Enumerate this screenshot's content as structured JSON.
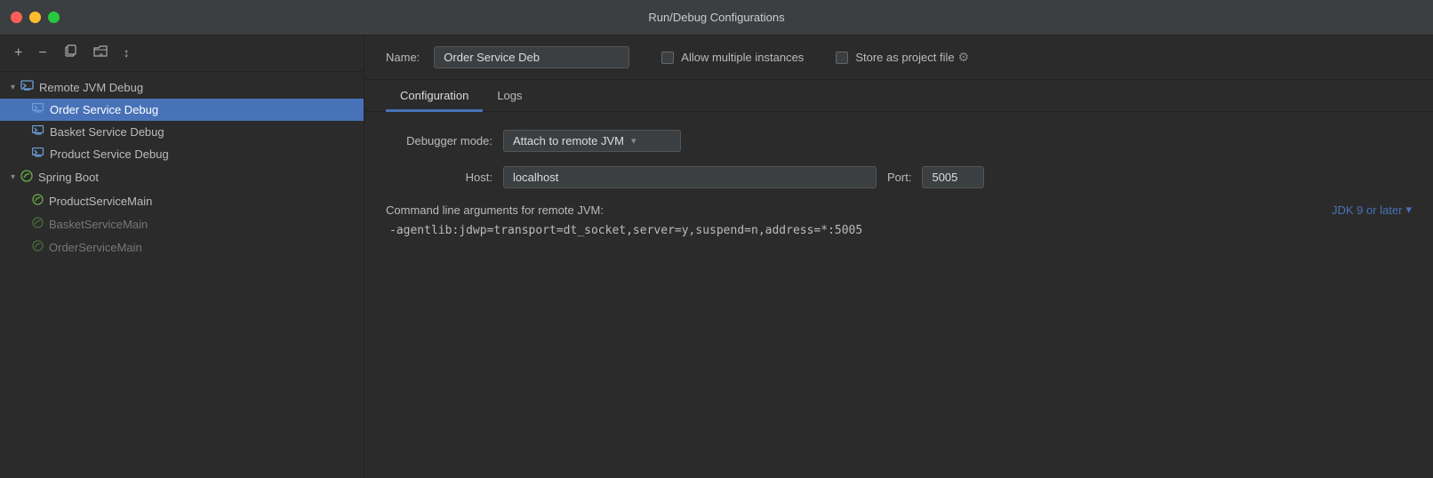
{
  "window": {
    "title": "Run/Debug Configurations"
  },
  "sidebar": {
    "toolbar": {
      "add_btn": "+",
      "remove_btn": "−",
      "copy_btn": "⧉",
      "folder_btn": "📁",
      "sort_btn": "↓₂"
    },
    "groups": [
      {
        "id": "remote-jvm",
        "label": "Remote JVM Debug",
        "icon": "🖥",
        "expanded": true,
        "items": [
          {
            "label": "Order Service Debug",
            "active": true,
            "dimmed": false
          },
          {
            "label": "Basket Service Debug",
            "active": false,
            "dimmed": false
          },
          {
            "label": "Product Service Debug",
            "active": false,
            "dimmed": false
          }
        ]
      },
      {
        "id": "spring-boot",
        "label": "Spring Boot",
        "icon": "🍃",
        "expanded": true,
        "items": [
          {
            "label": "ProductServiceMain",
            "active": false,
            "dimmed": false
          },
          {
            "label": "BasketServiceMain",
            "active": false,
            "dimmed": true
          },
          {
            "label": "OrderServiceMain",
            "active": false,
            "dimmed": true
          }
        ]
      }
    ]
  },
  "content": {
    "name_label": "Name:",
    "name_value": "Order Service Deb",
    "allow_multiple_instances": "Allow multiple instances",
    "store_as_project_file": "Store as project file",
    "tabs": [
      {
        "label": "Configuration",
        "active": true
      },
      {
        "label": "Logs",
        "active": false
      }
    ],
    "form": {
      "debugger_mode_label": "Debugger mode:",
      "debugger_mode_value": "Attach to remote JVM",
      "host_label": "Host:",
      "host_value": "localhost",
      "port_label": "Port:",
      "port_value": "5005",
      "cmd_label": "Command line arguments for remote JVM:",
      "jdk_link": "JDK 9 or later",
      "cmd_value": "-agentlib:jdwp=transport=dt_socket,server=y,suspend=n,address=*:5005"
    }
  }
}
